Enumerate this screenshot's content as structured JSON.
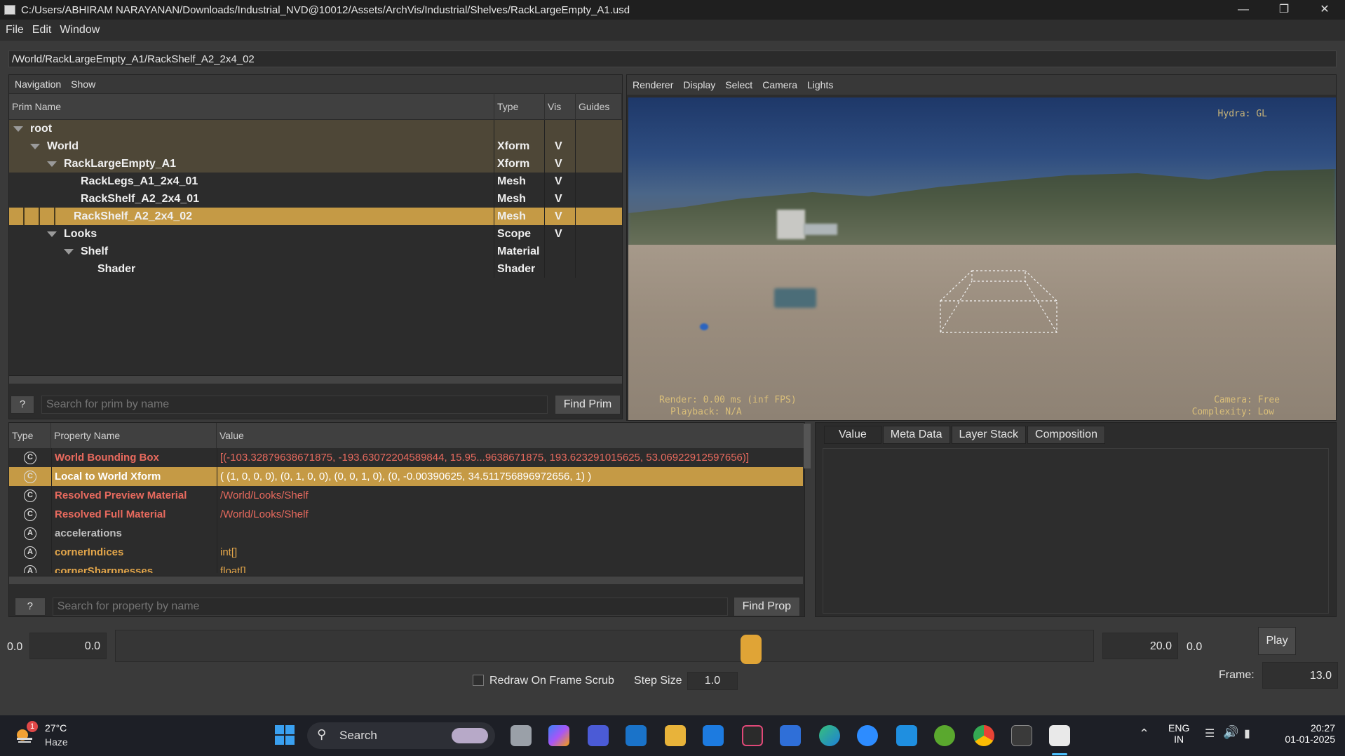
{
  "window": {
    "title": "C:/Users/ABHIRAM NARAYANAN/Downloads/Industrial_NVD@10012/Assets/ArchVis/Industrial/Shelves/RackLargeEmpty_A1.usd",
    "minimize": "—",
    "restore": "❐",
    "close": "✕"
  },
  "menu": [
    "File",
    "Edit",
    "Window"
  ],
  "path": "/World/RackLargeEmpty_A1/RackShelf_A2_2x4_02",
  "prim_panel": {
    "tabs": [
      "Navigation",
      "Show"
    ],
    "columns": [
      "Prim Name",
      "Type",
      "Vis",
      "Guides"
    ],
    "rows": [
      {
        "name": "root",
        "type": "",
        "vis": ""
      },
      {
        "name": "World",
        "type": "Xform",
        "vis": "V"
      },
      {
        "name": "RackLargeEmpty_A1",
        "type": "Xform",
        "vis": "V"
      },
      {
        "name": "RackLegs_A1_2x4_01",
        "type": "Mesh",
        "vis": "V"
      },
      {
        "name": "RackShelf_A2_2x4_01",
        "type": "Mesh",
        "vis": "V"
      },
      {
        "name": "RackShelf_A2_2x4_02",
        "type": "Mesh",
        "vis": "V"
      },
      {
        "name": "Looks",
        "type": "Scope",
        "vis": "V"
      },
      {
        "name": "Shelf",
        "type": "Material",
        "vis": ""
      },
      {
        "name": "Shader",
        "type": "Shader",
        "vis": ""
      }
    ],
    "search_help": "?",
    "search_placeholder": "Search for prim by name",
    "find_button": "Find Prim"
  },
  "viewport": {
    "menu": [
      "Renderer",
      "Display",
      "Select",
      "Camera",
      "Lights"
    ],
    "hud_renderer": "Hydra: GL",
    "hud_render": "Render: 0.00 ms (inf FPS)",
    "hud_playback": "Playback: N/A",
    "hud_camera": "Camera: Free",
    "hud_complexity": "Complexity: Low"
  },
  "properties": {
    "columns": [
      "Type",
      "Property Name",
      "Value"
    ],
    "rows": [
      {
        "icon": "C",
        "name": "World Bounding Box",
        "value": "[(-103.32879638671875, -193.63072204589844, 15.95...9638671875, 193.623291015625, 53.06922912597656)]"
      },
      {
        "icon": "C",
        "name": "Local to World Xform",
        "value": "( (1, 0, 0, 0), (0, 1, 0, 0), (0, 0, 1, 0), (0, -0.00390625, 34.511756896972656, 1) )"
      },
      {
        "icon": "C",
        "name": "Resolved Preview Material",
        "value": "/World/Looks/Shelf"
      },
      {
        "icon": "C",
        "name": "Resolved Full Material",
        "value": "/World/Looks/Shelf"
      },
      {
        "icon": "A",
        "name": "accelerations",
        "value": ""
      },
      {
        "icon": "A",
        "name": "cornerIndices",
        "value": "int[]"
      },
      {
        "icon": "A",
        "name": "cornerSharpnesses",
        "value": "float[]"
      }
    ],
    "search_help": "?",
    "search_placeholder": "Search for property by name",
    "find_button": "Find Prop"
  },
  "right_tabs": [
    "Value",
    "Meta Data",
    "Layer Stack",
    "Composition"
  ],
  "timeline": {
    "start_label": "0.0",
    "start_field": "0.0",
    "end_field": "20.0",
    "end_label": "0.0",
    "play": "Play",
    "frame_label": "Frame:",
    "frame_value": "13.0",
    "redraw_label": "Redraw On Frame Scrub",
    "step_label": "Step Size",
    "step_value": "1.0",
    "slider_position": 0.65
  },
  "taskbar": {
    "weather_temp": "27°C",
    "weather_desc": "Haze",
    "weather_badge": "1",
    "search": "Search",
    "lang_top": "ENG",
    "lang_bottom": "IN",
    "time": "20:27",
    "date": "01-01-2025"
  }
}
